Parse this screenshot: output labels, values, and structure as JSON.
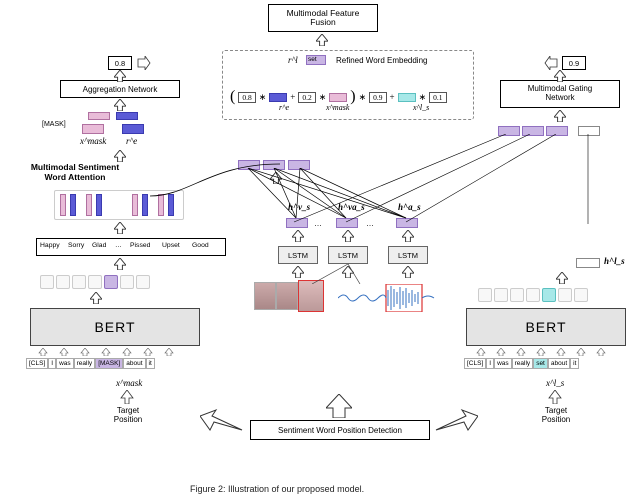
{
  "caption": "Figure 2: Illustration of our proposed model.",
  "top": {
    "fusion_label": "Multimodal Feature\nFusion",
    "refine_header_symbol": "r^l",
    "refine_header_word": "set",
    "refine_header_label": "Refined Word Embedding",
    "formula": {
      "w1": "0.8",
      "term1": "r^e",
      "w2": "0.2",
      "term2": "x^mask",
      "w3": "0.9",
      "term3": "x^l_s",
      "w4": "0.1"
    }
  },
  "left_branch": {
    "score_box": "0.8",
    "agg_label": "Aggregation Network",
    "mask_label": "[MASK]",
    "x_mask": "x^mask",
    "r_e": "r^e",
    "att_label": "Multimodal Sentiment\nWord Attention",
    "words": [
      "Happy",
      "Sorry",
      "Glad",
      "…",
      "Pissed",
      "Upset",
      "Good"
    ],
    "bert": "BERT",
    "tokens": [
      "[CLS]",
      "I",
      "was",
      "really",
      "[MASK]",
      "about",
      "it"
    ],
    "mask_token_idx": 4,
    "xmask_under": "x^mask",
    "target_pos": "Target\nPosition"
  },
  "middle_branch": {
    "h_v": "h^v_s",
    "h_va": "h^va_s",
    "h_a": "h^a_s",
    "lstm": "LSTM",
    "ellipsis": "…",
    "detector": "Sentiment Word Position Detection"
  },
  "right_branch": {
    "score_box": "0.9",
    "gate_label": "Multimodal Gating\nNetwork",
    "h_l": "h^l_s",
    "bert": "BERT",
    "tokens": [
      "[CLS]",
      "I",
      "was",
      "really",
      "set",
      "about",
      "it"
    ],
    "target_token_idx": 4,
    "xls_under": "x^l_s",
    "target_pos": "Target\nPosition"
  }
}
